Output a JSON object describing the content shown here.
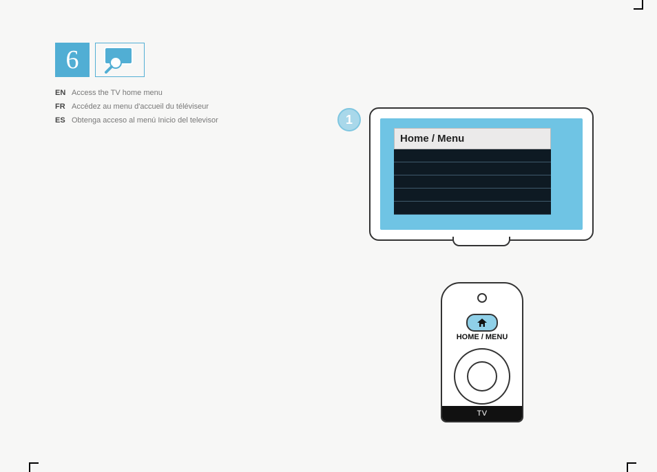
{
  "step_number": "6",
  "instructions": [
    {
      "lang": "EN",
      "text": "Access the TV home menu"
    },
    {
      "lang": "FR",
      "text": "Accédez au menu d'accueil du téléviseur"
    },
    {
      "lang": "ES",
      "text": "Obtenga acceso al menú Inicio del televisor"
    }
  ],
  "callout_number": "1",
  "tv_menu": {
    "header": "Home / Menu"
  },
  "remote": {
    "home_label": "HOME / MENU",
    "bottom_label": "TV"
  }
}
